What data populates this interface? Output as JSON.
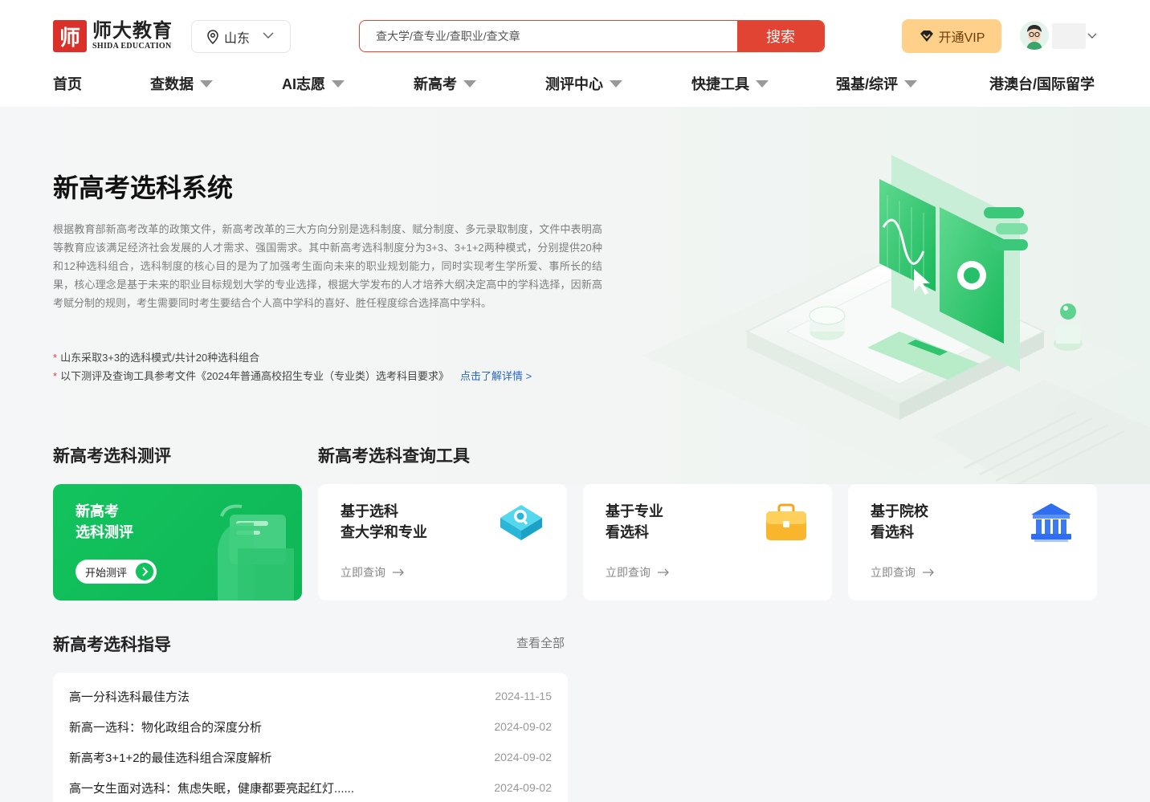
{
  "brand": {
    "logo_char": "师",
    "name_cn": "师大教育",
    "name_en": "SHIDA EDUCATION"
  },
  "location": {
    "label": "山东"
  },
  "search": {
    "placeholder": "查大学/查专业/查职业/查文章",
    "button": "搜索"
  },
  "vip": {
    "label": "开通VIP"
  },
  "nav": [
    {
      "label": "首页",
      "dropdown": false
    },
    {
      "label": "查数据",
      "dropdown": true
    },
    {
      "label": "AI志愿",
      "dropdown": true
    },
    {
      "label": "新高考",
      "dropdown": true
    },
    {
      "label": "测评中心",
      "dropdown": true
    },
    {
      "label": "快捷工具",
      "dropdown": true
    },
    {
      "label": "强基/综评",
      "dropdown": true
    },
    {
      "label": "港澳台/国际留学",
      "dropdown": false
    }
  ],
  "hero": {
    "title": "新高考选科系统",
    "description": "根据教育部新高考改革的政策文件，新高考改革的三大方向分别是选科制度、赋分制度、多元录取制度，文件中表明高等教育应该满足经济社会发展的人才需求、强国需求。其中新高考选科制度分为3+3、3+1+2两种模式，分别提供20种和12种选科组合，选科制度的核心目的是为了加强考生面向未来的职业规划能力，同时实现考生学所爱、事所长的结果，核心理念是基于未来的职业目标规划大学的专业选择，根据大学发布的人才培养大纲决定高中的学科选择，因新高考赋分制的规则，考生需要同时考生要结合个人高中学科的喜好、胜任程度综合选择高中学科。",
    "note1": "山东采取3+3的选科模式/共计20种选科组合",
    "note2": "以下测评及查询工具参考文件《2024年普通高校招生专业（专业类）选考科目要求》",
    "note2_link": "点击了解详情 >",
    "star": "*"
  },
  "sections": {
    "eval_title": "新高考选科测评",
    "tools_title": "新高考选科查询工具"
  },
  "eval_card": {
    "line1": "新高考",
    "line2": "选科测评",
    "button": "开始测评"
  },
  "tool_cards": [
    {
      "line1": "基于选科",
      "line2": "查大学和专业",
      "action": "立即查询",
      "icon": "search-diamond-icon"
    },
    {
      "line1": "基于专业",
      "line2": "看选科",
      "action": "立即查询",
      "icon": "briefcase-icon"
    },
    {
      "line1": "基于院校",
      "line2": "看选科",
      "action": "立即查询",
      "icon": "university-icon"
    }
  ],
  "guide": {
    "title": "新高考选科指导",
    "view_all": "查看全部",
    "items": [
      {
        "title": "高一分科选科最佳方法",
        "date": "2024-11-15"
      },
      {
        "title": "新高一选科：物化政组合的深度分析",
        "date": "2024-09-02"
      },
      {
        "title": "新高考3+1+2的最佳选科组合深度解析",
        "date": "2024-09-02"
      },
      {
        "title": "高一女生面对选科：焦虑失眠，健康都要亮起红灯......",
        "date": "2024-09-02"
      }
    ]
  },
  "colors": {
    "brand_red": "#e14432",
    "green": "#12c35d",
    "vip_gold": "#ffd089",
    "link_blue": "#2a66c9"
  }
}
